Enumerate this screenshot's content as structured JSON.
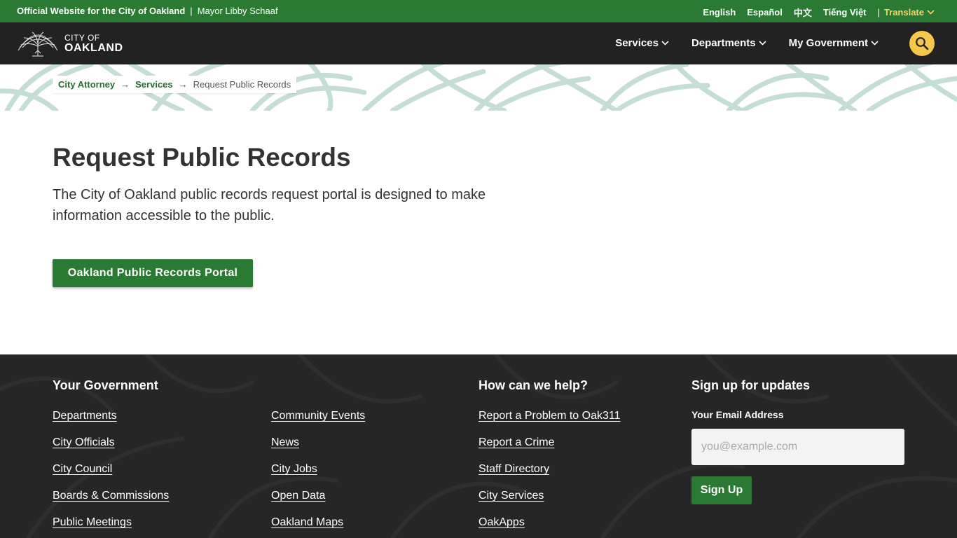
{
  "util_bar": {
    "official": "Official Website for the City of Oakland",
    "separator": "|",
    "mayor": "Mayor Libby Schaaf",
    "languages": [
      "English",
      "Español",
      "中文",
      "Tiếng Việt"
    ],
    "translate": "Translate"
  },
  "nav": {
    "logo_line1": "CITY OF",
    "logo_line2": "OAKLAND",
    "items": [
      "Services",
      "Departments",
      "My Government"
    ]
  },
  "breadcrumb": {
    "items": [
      "City Attorney",
      "Services"
    ],
    "arrow": "→",
    "current": "Request Public Records"
  },
  "main": {
    "title": "Request Public Records",
    "intro": "The City of Oakland public records request portal is designed to make information accessible to the public.",
    "portal_button": "Oakland Public Records Portal"
  },
  "footer": {
    "your_government": {
      "heading": "Your Government",
      "col1": [
        "Departments",
        "City Officials",
        "City Council",
        "Boards & Commissions",
        "Public Meetings"
      ],
      "col2": [
        "Community Events",
        "News",
        "City Jobs",
        "Open Data",
        "Oakland Maps"
      ]
    },
    "help": {
      "heading": "How can we help?",
      "links": [
        "Report a Problem to Oak311",
        "Report a Crime",
        "Staff Directory",
        "City Services",
        "OakApps"
      ]
    },
    "signup": {
      "heading": "Sign up for updates",
      "email_label": "Your Email Address",
      "email_placeholder": "you@example.com",
      "button": "Sign Up"
    }
  },
  "colors": {
    "brand_green": "#2a7a34",
    "nav_dark": "#222222",
    "accent_yellow": "#f5c84c",
    "footer_dark": "#262626"
  }
}
